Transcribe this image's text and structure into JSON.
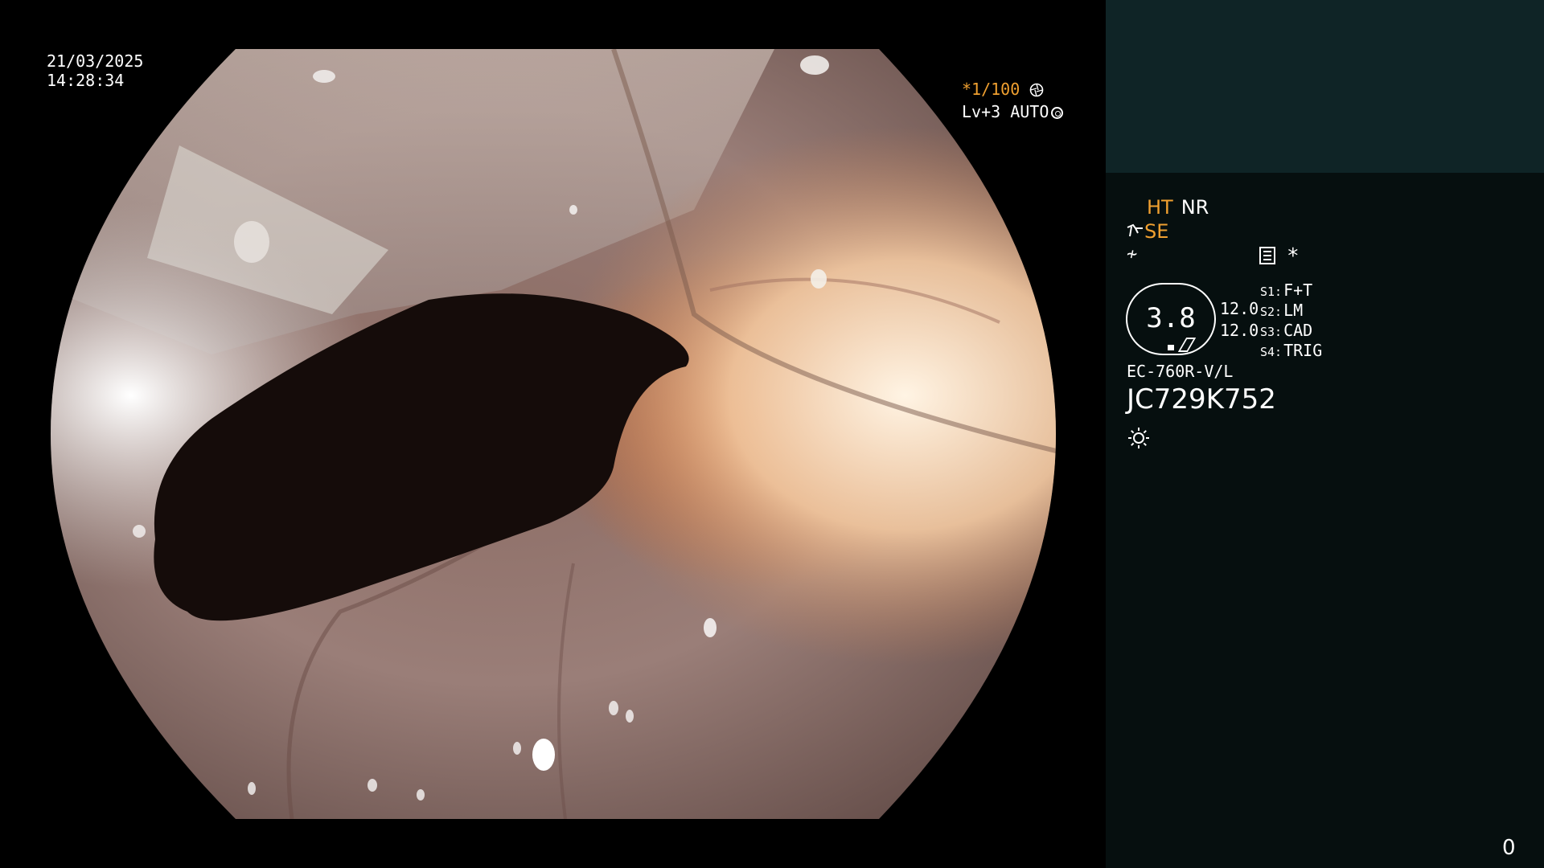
{
  "overlay": {
    "date": "21/03/2025",
    "time": "14:28:34",
    "shutter_prefix": "*",
    "shutter_value": "1/100",
    "iris_label": "Lv+3 AUTO"
  },
  "panel": {
    "mode_ht": "HT",
    "mode_nr": "NR",
    "mode_se": "SE",
    "tilde_symbol": "≁",
    "asterisk": "*",
    "gauge_value": "3.8",
    "gauge_num1": "12.0",
    "gauge_num2": "12.0",
    "switches": [
      {
        "key": "S1:",
        "value": "F+T"
      },
      {
        "key": "S2:",
        "value": "LM"
      },
      {
        "key": "S3:",
        "value": "CAD"
      },
      {
        "key": "S4:",
        "value": "TRIG"
      }
    ],
    "scope_model": "EC-760R-V/L",
    "scope_serial": "JC729K752",
    "counter": "0"
  },
  "colors": {
    "accent": "#f0a030",
    "panel_top": "#0f2426",
    "panel_bottom": "#060f0f"
  },
  "icons": [
    "aperture-icon",
    "iris-ring-icon",
    "hand-icon",
    "tilde-icon",
    "menu-icon",
    "light-source-icon"
  ]
}
